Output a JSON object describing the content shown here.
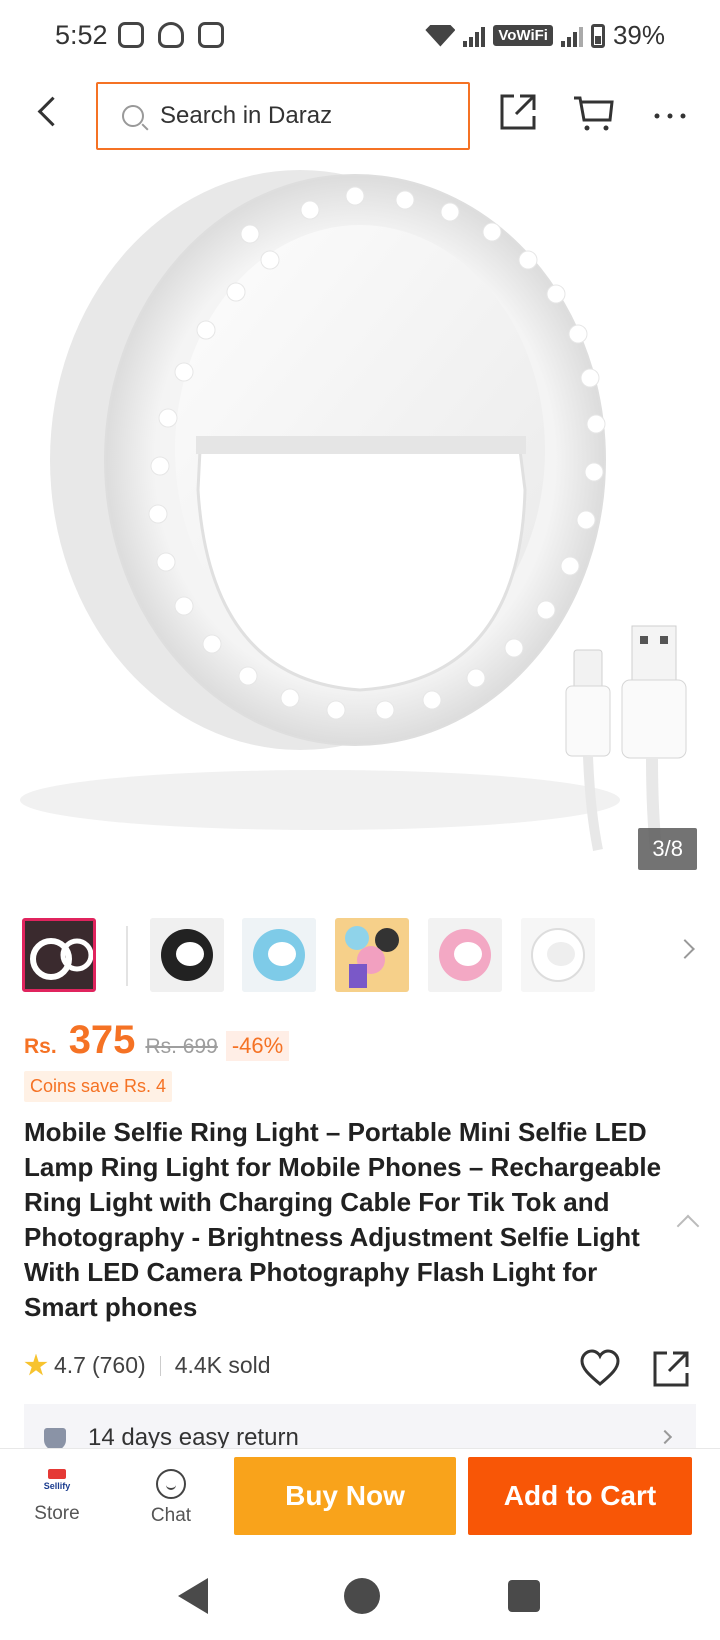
{
  "status_bar": {
    "time": "5:52",
    "network_label": "VoWiFi",
    "battery": "39%"
  },
  "header": {
    "search_placeholder": "Search in Daraz"
  },
  "gallery": {
    "counter": "3/8",
    "current_index": 3,
    "total_images": 8
  },
  "thumbnails": [
    {
      "variant": "ring-light-lifestyle",
      "active": true
    },
    {
      "variant": "black-ring"
    },
    {
      "variant": "blue-ring"
    },
    {
      "variant": "colorful-set"
    },
    {
      "variant": "pink-ring"
    },
    {
      "variant": "white-ring"
    }
  ],
  "price": {
    "currency": "Rs.",
    "value": "375",
    "original": "Rs. 699",
    "discount": "-46%",
    "coins": "Coins save Rs. 4"
  },
  "product": {
    "title": "Mobile Selfie Ring Light – Portable Mini Selfie LED Lamp Ring Light for Mobile Phones – Rechargeable Ring Light with Charging Cable For Tik Tok and Photography - Brightness Adjustment Selfie Light With LED Camera Photography Flash Light for Smart phones",
    "rating": "4.7",
    "reviews": "(760)",
    "sold": "4.4K sold"
  },
  "service": {
    "return_policy": "14 days easy return"
  },
  "bottom_bar": {
    "store_label": "Store",
    "store_logo_text": "Sellify",
    "chat_label": "Chat",
    "buy_now_label": "Buy Now",
    "add_to_cart_label": "Add to Cart"
  },
  "colors": {
    "accent": "#f57224",
    "buy_now": "#f9a31b",
    "add_to_cart": "#f85606"
  }
}
